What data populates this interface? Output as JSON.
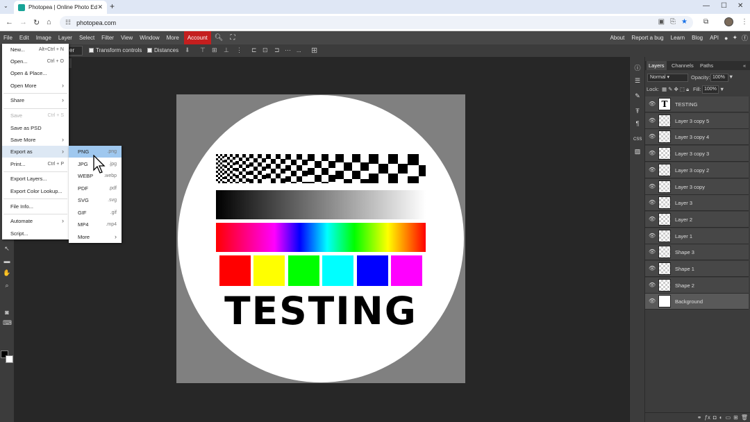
{
  "browser": {
    "tab_title": "Photopea | Online Photo Editor",
    "tab_close": "✕",
    "new_tab": "+",
    "url": "photopea.com"
  },
  "menubar": {
    "items": [
      "File",
      "Edit",
      "Image",
      "Layer",
      "Select",
      "Filter",
      "View",
      "Window",
      "More"
    ],
    "account": "Account",
    "right": [
      "About",
      "Report a bug",
      "Learn",
      "Blog",
      "API"
    ]
  },
  "options": {
    "select_fragment": "er",
    "transform_controls": "Transform controls",
    "distances": "Distances",
    "more": "..."
  },
  "file_menu": {
    "items": [
      {
        "label": "New...",
        "shortcut": "Alt+Ctrl + N"
      },
      {
        "label": "Open...",
        "shortcut": "Ctrl + O"
      },
      {
        "label": "Open & Place..."
      },
      {
        "label": "Open More",
        "arrow": "›"
      },
      {
        "label": "Share",
        "arrow": "›"
      },
      {
        "label": "Save",
        "shortcut": "Ctrl + S"
      },
      {
        "label": "Save as PSD"
      },
      {
        "label": "Save More",
        "arrow": "›"
      },
      {
        "label": "Export as",
        "arrow": "›"
      },
      {
        "label": "Print...",
        "shortcut": "Ctrl + P"
      },
      {
        "label": "Export Layers..."
      },
      {
        "label": "Export Color Lookup..."
      },
      {
        "label": "File Info..."
      },
      {
        "label": "Automate",
        "arrow": "›"
      },
      {
        "label": "Script..."
      }
    ]
  },
  "export_submenu": {
    "items": [
      {
        "label": "PNG",
        "ext": ".png"
      },
      {
        "label": "JPG",
        "ext": ".jpg"
      },
      {
        "label": "WEBP",
        "ext": ".webp"
      },
      {
        "label": "PDF",
        "ext": ".pdf"
      },
      {
        "label": "SVG",
        "ext": ".svg"
      },
      {
        "label": "GIF",
        "ext": ".gif"
      },
      {
        "label": "MP4",
        "ext": ".mp4"
      },
      {
        "label": "More",
        "arrow": "›"
      }
    ]
  },
  "canvas": {
    "text": "TESTING",
    "swatch_colors": [
      "#ff0000",
      "#ffff00",
      "#00ff00",
      "#00ffff",
      "#0000ff",
      "#ff00ff"
    ]
  },
  "panel": {
    "tabs": [
      "Layers",
      "Channels",
      "Paths"
    ],
    "blend_mode": "Normal",
    "opacity_label": "Opacity:",
    "opacity": "100%",
    "lock_label": "Lock:",
    "fill_label": "Fill:",
    "fill": "100%",
    "layers": [
      {
        "name": "TESTING",
        "thumb": "T"
      },
      {
        "name": "Layer 3 copy 5"
      },
      {
        "name": "Layer 3 copy 4"
      },
      {
        "name": "Layer 3 copy 3"
      },
      {
        "name": "Layer 3 copy 2"
      },
      {
        "name": "Layer 3 copy"
      },
      {
        "name": "Layer 3"
      },
      {
        "name": "Layer 2"
      },
      {
        "name": "Layer 1"
      },
      {
        "name": "Shape 3"
      },
      {
        "name": "Shape 1"
      },
      {
        "name": "Shape 2"
      },
      {
        "name": "Background"
      }
    ]
  },
  "right_tools": {
    "css_label": "CSS"
  }
}
